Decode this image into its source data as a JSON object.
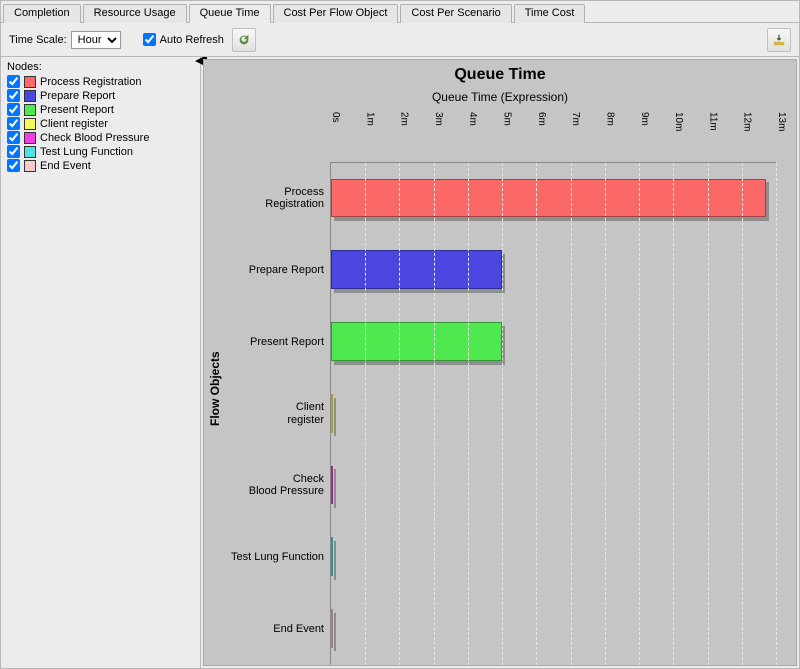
{
  "tabs": [
    "Completion",
    "Resource Usage",
    "Queue Time",
    "Cost Per Flow Object",
    "Cost Per Scenario",
    "Time Cost"
  ],
  "active_tab_index": 2,
  "toolbar": {
    "time_scale_label": "Time Scale:",
    "time_scale_value": "Hour",
    "auto_refresh_label": "Auto Refresh",
    "auto_refresh_checked": true
  },
  "sidebar": {
    "title": "Nodes:",
    "nodes": [
      {
        "label": "Process Registration",
        "color": "#fa6967",
        "checked": true
      },
      {
        "label": "Prepare Report",
        "color": "#4b46e0",
        "checked": true
      },
      {
        "label": "Present Report",
        "color": "#4fe84f",
        "checked": true
      },
      {
        "label": "Client register",
        "color": "#f7f759",
        "checked": true
      },
      {
        "label": "Check Blood Pressure",
        "color": "#f23ee2",
        "checked": true
      },
      {
        "label": "Test Lung Function",
        "color": "#4fe4e2",
        "checked": true
      },
      {
        "label": "End Event",
        "color": "#f7c9c9",
        "checked": true
      }
    ]
  },
  "chart": {
    "title": "Queue Time",
    "subtitle": "Queue Time (Expression)",
    "ylabel": "Flow Objects",
    "ticks": [
      "0s",
      "1m",
      "2m",
      "3m",
      "4m",
      "5m",
      "6m",
      "7m",
      "8m",
      "9m",
      "10m",
      "11m",
      "12m",
      "13m"
    ]
  },
  "chart_data": {
    "type": "bar",
    "orientation": "horizontal",
    "title": "Queue Time",
    "subtitle": "Queue Time (Expression)",
    "xlabel": "Queue Time (Expression)",
    "ylabel": "Flow Objects",
    "xlim": [
      0,
      13
    ],
    "x_unit": "minutes",
    "categories": [
      "Process Registration",
      "Prepare Report",
      "Present Report",
      "Client register",
      "Check Blood Pressure",
      "Test Lung Function",
      "End Event"
    ],
    "values": [
      12.7,
      5.0,
      5.0,
      0.05,
      0.05,
      0.05,
      0.05
    ],
    "colors": [
      "#fa6967",
      "#4b46e0",
      "#4fe84f",
      "#f7f759",
      "#f23ee2",
      "#4fe4e2",
      "#f7c9c9"
    ]
  }
}
